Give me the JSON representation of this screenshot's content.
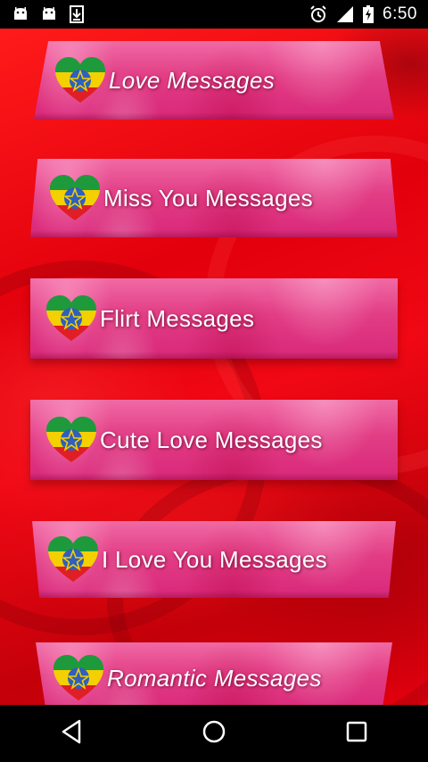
{
  "status_bar": {
    "time": "6:50",
    "icons": [
      "android-notification-icon",
      "android-notification-icon",
      "download-icon",
      "alarm-icon",
      "signal-icon",
      "battery-charging-icon"
    ]
  },
  "menu": {
    "items": [
      {
        "label": "Love Messages",
        "icon": "ethiopian-flag-heart-icon"
      },
      {
        "label": "Miss You Messages",
        "icon": "ethiopian-flag-heart-icon"
      },
      {
        "label": "Flirt Messages",
        "icon": "ethiopian-flag-heart-icon"
      },
      {
        "label": "Cute Love Messages",
        "icon": "ethiopian-flag-heart-icon"
      },
      {
        "label": "I Love You Messages",
        "icon": "ethiopian-flag-heart-icon"
      },
      {
        "label": "Romantic Messages",
        "icon": "ethiopian-flag-heart-icon"
      }
    ]
  },
  "nav_bar": {
    "buttons": [
      "back-icon",
      "home-icon",
      "recents-icon"
    ]
  },
  "colors": {
    "background": "#e2000c",
    "card": "#e23d85",
    "flag_green": "#1e9a3c",
    "flag_yellow": "#f4d000",
    "flag_red": "#e01e25",
    "emblem_blue": "#2f5fbf"
  }
}
